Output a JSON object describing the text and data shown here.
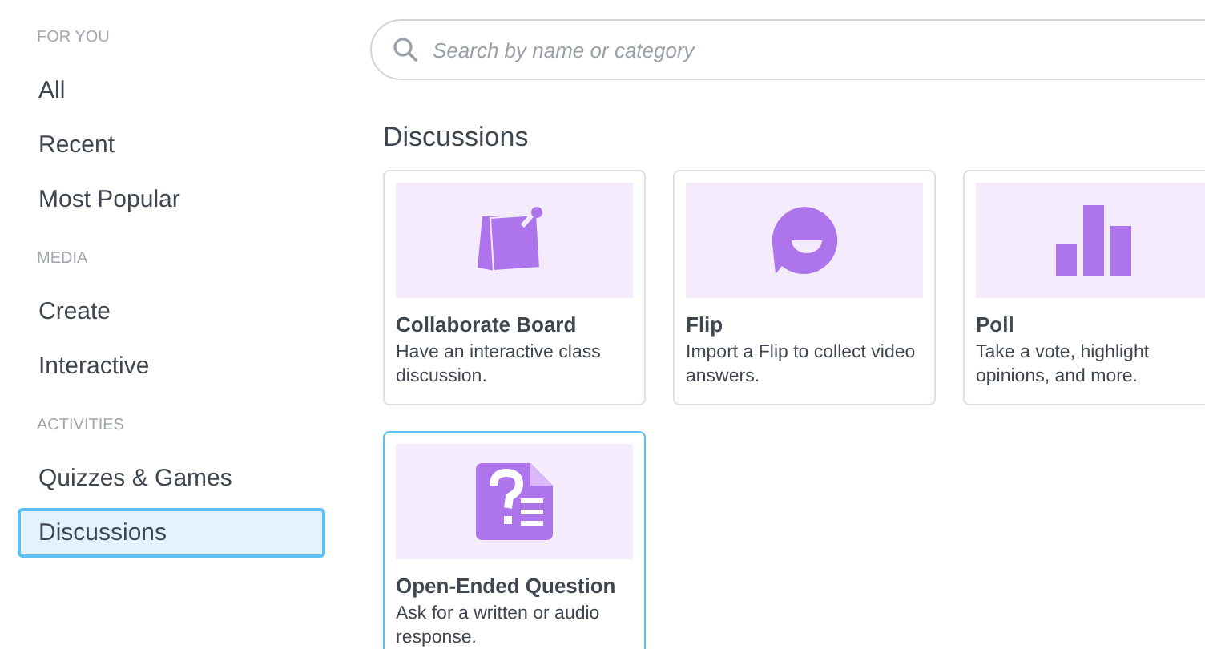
{
  "sidebar": {
    "sections": [
      {
        "heading": "FOR YOU",
        "items": [
          {
            "label": "All",
            "selected": false
          },
          {
            "label": "Recent",
            "selected": false
          },
          {
            "label": "Most Popular",
            "selected": false
          }
        ]
      },
      {
        "heading": "MEDIA",
        "items": [
          {
            "label": "Create",
            "selected": false
          },
          {
            "label": "Interactive",
            "selected": false
          }
        ]
      },
      {
        "heading": "ACTIVITIES",
        "items": [
          {
            "label": "Quizzes & Games",
            "selected": false
          },
          {
            "label": "Discussions",
            "selected": true
          }
        ]
      }
    ]
  },
  "search": {
    "placeholder": "Search by name or category"
  },
  "section_title": "Discussions",
  "cards": [
    {
      "kind": "board",
      "title": "Collaborate Board",
      "description": "Have an interactive class discussion.",
      "selected": false
    },
    {
      "kind": "flip",
      "title": "Flip",
      "description": "Import a Flip to collect video answers.",
      "selected": false
    },
    {
      "kind": "poll",
      "title": "Poll",
      "description": "Take a vote, highlight opinions, and more.",
      "selected": false
    },
    {
      "kind": "question",
      "title": "Open-Ended Question",
      "description": "Ask for a written or audio response.",
      "selected": true
    }
  ]
}
